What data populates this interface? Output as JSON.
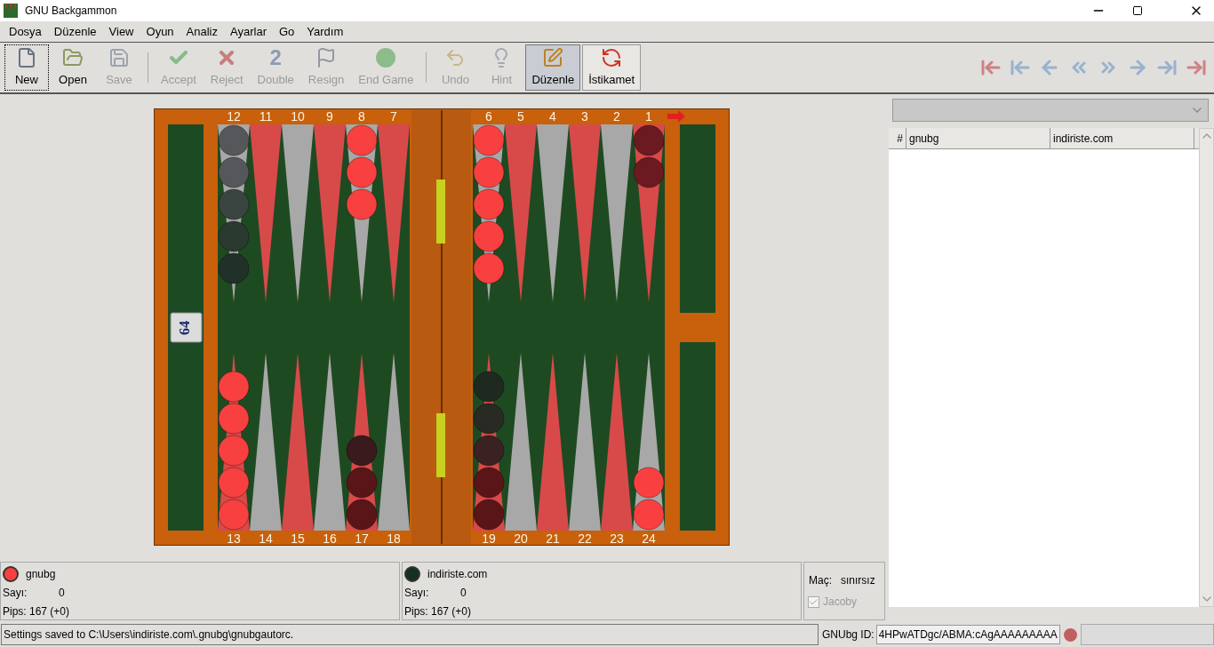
{
  "window": {
    "title": "GNU Backgammon"
  },
  "menu": [
    "Dosya",
    "Düzenle",
    "View",
    "Oyun",
    "Analiz",
    "Ayarlar",
    "Go",
    "Yardım"
  ],
  "toolbar": [
    {
      "kind": "button",
      "label": "New",
      "disabled": false,
      "focused": true
    },
    {
      "kind": "button",
      "label": "Open",
      "disabled": false,
      "focused": false
    },
    {
      "kind": "button",
      "label": "Save",
      "disabled": true,
      "focused": false
    },
    {
      "kind": "separator"
    },
    {
      "kind": "button",
      "label": "Accept",
      "disabled": true,
      "focused": false
    },
    {
      "kind": "button",
      "label": "Reject",
      "disabled": true,
      "focused": false
    },
    {
      "kind": "button",
      "label": "Double",
      "disabled": true,
      "focused": false,
      "glyph": "2"
    },
    {
      "kind": "button",
      "label": "Resign",
      "disabled": true,
      "focused": false
    },
    {
      "kind": "button",
      "label": "End Game",
      "disabled": true,
      "focused": false
    },
    {
      "kind": "separator"
    },
    {
      "kind": "button",
      "label": "Undo",
      "disabled": true,
      "focused": false
    },
    {
      "kind": "button",
      "label": "Hint",
      "disabled": true,
      "focused": false
    },
    {
      "kind": "toggle",
      "label": "Düzenle",
      "on": true
    },
    {
      "kind": "toggle",
      "label": "İstikamet",
      "on": false
    }
  ],
  "board": {
    "top_points": [
      {
        "label": "12",
        "checkers": [
          {
            "color": "#55575a"
          },
          {
            "color": "#55575a"
          },
          {
            "color": "#3a4440"
          },
          {
            "color": "#2a3a30"
          },
          {
            "color": "#22302a"
          }
        ]
      },
      {
        "label": "11"
      },
      {
        "label": "10"
      },
      {
        "label": "9"
      },
      {
        "label": "8",
        "checkers": [
          {
            "color": "#f84040"
          },
          {
            "color": "#f84040"
          },
          {
            "color": "#f84040"
          }
        ]
      },
      {
        "label": "7"
      },
      {
        "label": "6",
        "checkers": [
          {
            "color": "#f84040"
          },
          {
            "color": "#f84040"
          },
          {
            "color": "#f84040"
          },
          {
            "color": "#f84040"
          },
          {
            "color": "#f84040"
          }
        ]
      },
      {
        "label": "5"
      },
      {
        "label": "4"
      },
      {
        "label": "3"
      },
      {
        "label": "2"
      },
      {
        "label": "1",
        "checkers": [
          {
            "color": "#6a1a20"
          },
          {
            "color": "#6a1a20"
          }
        ]
      }
    ],
    "cube": "64",
    "bottom_points": [
      {
        "label": "13",
        "checkers": [
          {
            "color": "#f84040"
          },
          {
            "color": "#f84040"
          },
          {
            "color": "#f84040"
          },
          {
            "color": "#f84040"
          },
          {
            "color": "#f84040"
          }
        ]
      },
      {
        "label": "14"
      },
      {
        "label": "15"
      },
      {
        "label": "16"
      },
      {
        "label": "17",
        "checkers": [
          {
            "color": "#5a1518"
          },
          {
            "color": "#5a1518"
          },
          {
            "color": "#3a1a1c"
          }
        ]
      },
      {
        "label": "18"
      },
      {
        "label": "19",
        "checkers": [
          {
            "color": "#5a1518"
          },
          {
            "color": "#5a1518"
          },
          {
            "color": "#3a2222"
          },
          {
            "color": "#2a2a24"
          },
          {
            "color": "#1e2a20"
          }
        ]
      },
      {
        "label": "20"
      },
      {
        "label": "21"
      },
      {
        "label": "22"
      },
      {
        "label": "23"
      },
      {
        "label": "24",
        "checkers": [
          {
            "color": "#f84040"
          },
          {
            "color": "#f84040"
          }
        ]
      }
    ]
  },
  "game_list": {
    "columns": [
      "#",
      "gnubg",
      "indiriste.com"
    ]
  },
  "players": [
    {
      "name": "gnubg",
      "color": "#f84040",
      "score_label": "Sayı:",
      "score": "0",
      "pips": "Pips: 167 (+0)"
    },
    {
      "name": "indiriste.com",
      "color": "#15301e",
      "score_label": "Sayı:",
      "score": "0",
      "pips": "Pips: 167 (+0)"
    }
  ],
  "match": {
    "label": "Maç:",
    "value": "sınırsız",
    "jacoby": {
      "label": "Jacoby",
      "checked": true,
      "disabled": true
    }
  },
  "status_bar": {
    "message": "Settings saved to C:\\Users\\indiriste.com\\.gnubg\\gnubgautorc.",
    "id_label": "GNUbg ID:",
    "id_value": "4HPwATDgc/ABMA:cAgAAAAAAAAA"
  }
}
